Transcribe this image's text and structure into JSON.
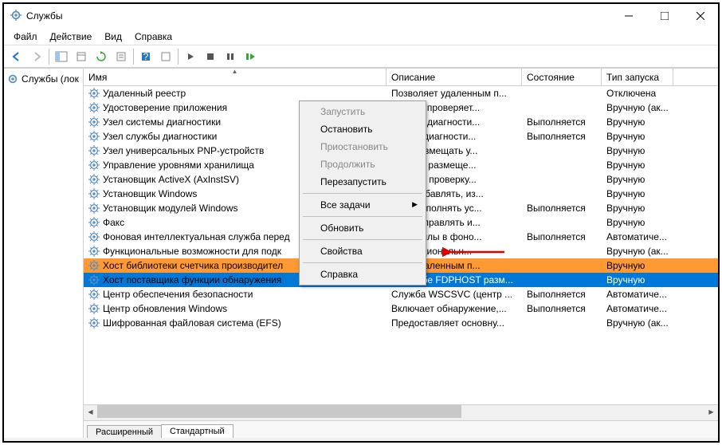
{
  "window": {
    "title": "Службы"
  },
  "menu": {
    "file": "Файл",
    "action": "Действие",
    "view": "Вид",
    "help": "Справка"
  },
  "tree": {
    "root": "Службы (лок"
  },
  "columns": {
    "name": "Имя",
    "desc": "Описание",
    "state": "Состояние",
    "start": "Тип запуска"
  },
  "services": [
    {
      "name": "Удаленный реестр",
      "desc": "Позволяет удаленным п...",
      "state": "",
      "start": "Отключена"
    },
    {
      "name": "Удостоверение приложения",
      "desc": "еляет и проверяет...",
      "state": "",
      "start": "Вручную (ак..."
    },
    {
      "name": "Узел системы диагностики",
      "desc": "истемы диагности...",
      "state": "Выполняется",
      "start": "Вручную"
    },
    {
      "name": "Узел службы диагностики",
      "desc": "лужбы диагности...",
      "state": "Выполняется",
      "start": "Вручную"
    },
    {
      "name": "Узел универсальных PNP-устройств",
      "desc": "ляет размещать у...",
      "state": "",
      "start": "Вручную"
    },
    {
      "name": "Управление уровнями хранилища",
      "desc": "изирует размеще...",
      "state": "",
      "start": "Вручную"
    },
    {
      "name": "Установщик ActiveX (AxInstSV)",
      "desc": "ечивает проверку...",
      "state": "",
      "start": "Вручную"
    },
    {
      "name": "Установщик Windows",
      "desc": "ляет добавлять, из...",
      "state": "",
      "start": "Вручную"
    },
    {
      "name": "Установщик модулей Windows",
      "desc": "ляет выполнять ус...",
      "state": "Выполняется",
      "start": "Вручную"
    },
    {
      "name": "Факс",
      "desc": "ляет отправлять и...",
      "state": "",
      "start": "Вручную"
    },
    {
      "name": "Фоновая интеллектуальная служба перед",
      "desc": "ает файлы в фоно...",
      "state": "Выполняется",
      "start": "Автоматиче..."
    },
    {
      "name": "Функциональные возможности для подк",
      "desc": "а функциональн...",
      "state": "",
      "start": "Вручную (ак..."
    },
    {
      "name": "Хост библиотеки счетчика производител",
      "desc": "ляет удаленным п...",
      "state": "",
      "start": "Вручную",
      "sel": true
    },
    {
      "name": "Хост поставщика функции обнаружения",
      "desc": "В службе FDPHOST разм...",
      "state": "",
      "start": "Вручную",
      "hi": true
    },
    {
      "name": "Центр обеспечения безопасности",
      "desc": "Служба WSCSVC (центр ...",
      "state": "Выполняется",
      "start": "Автоматиче..."
    },
    {
      "name": "Центр обновления Windows",
      "desc": "Включает обнаружение,...",
      "state": "Выполняется",
      "start": "Автоматиче..."
    },
    {
      "name": "Шифрованная файловая система (EFS)",
      "desc": "Предоставляет основну...",
      "state": "",
      "start": "Вручную (ак..."
    }
  ],
  "tabs": {
    "ext": "Расширенный",
    "std": "Стандартный"
  },
  "context": {
    "start": "Запустить",
    "stop": "Остановить",
    "pause": "Приостановить",
    "resume": "Продолжить",
    "restart": "Перезапустить",
    "alltasks": "Все задачи",
    "refresh": "Обновить",
    "props": "Свойства",
    "help": "Справка"
  }
}
